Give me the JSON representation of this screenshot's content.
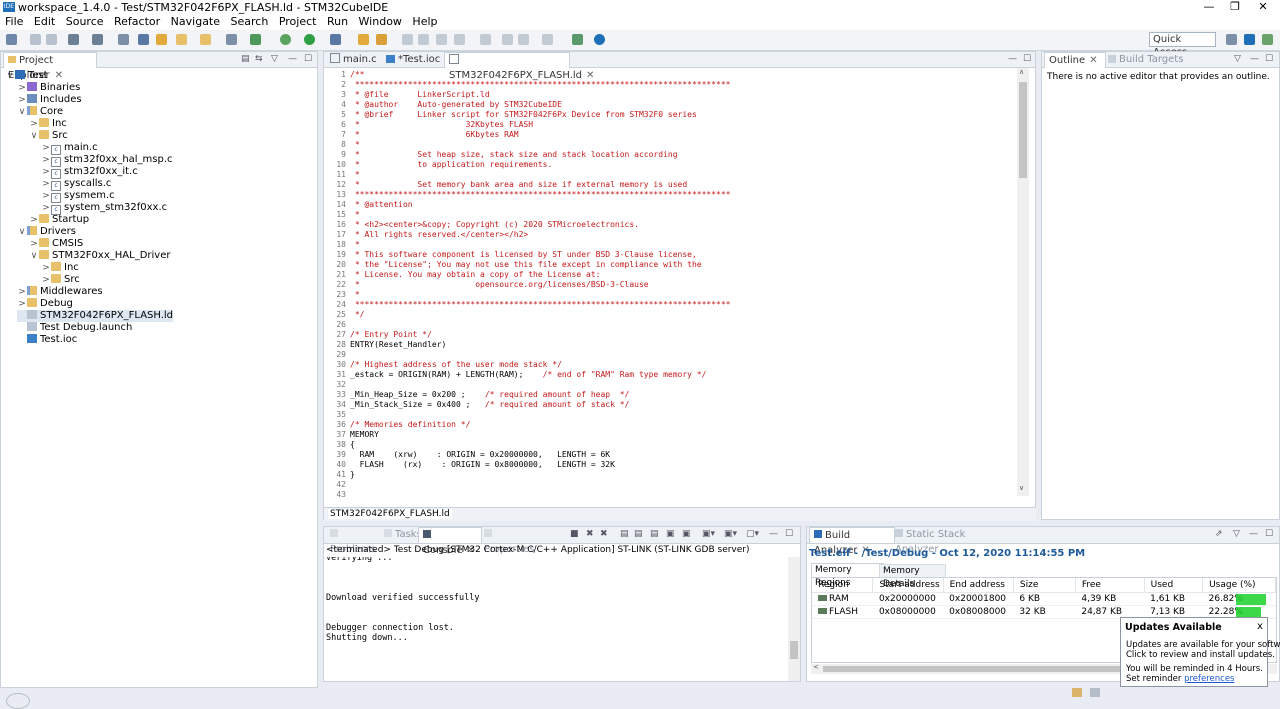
{
  "window": {
    "title": "workspace_1.4.0 - Test/STM32F042F6PX_FLASH.ld - STM32CubeIDE",
    "app_icon_label": "IDE",
    "minimize": "—",
    "restore": "❐",
    "close": "✕"
  },
  "menu": [
    "File",
    "Edit",
    "Source",
    "Refactor",
    "Navigate",
    "Search",
    "Project",
    "Run",
    "Window",
    "Help"
  ],
  "toolbar": {
    "quick_access_placeholder": "Quick Access"
  },
  "explorer": {
    "tab_label": "Project Explorer",
    "tree": [
      {
        "label": "Test",
        "indent": 0,
        "chev": "∨",
        "icon": "project-icon"
      },
      {
        "label": "Binaries",
        "indent": 1,
        "chev": ">",
        "icon": "binaries-icon"
      },
      {
        "label": "Includes",
        "indent": 1,
        "chev": ">",
        "icon": "includes-icon"
      },
      {
        "label": "Core",
        "indent": 1,
        "chev": "∨",
        "icon": "source-folder-icon"
      },
      {
        "label": "Inc",
        "indent": 2,
        "chev": ">",
        "icon": "folder-icon"
      },
      {
        "label": "Src",
        "indent": 2,
        "chev": "∨",
        "icon": "folder-icon"
      },
      {
        "label": "main.c",
        "indent": 3,
        "chev": ">",
        "icon": "c-file-icon"
      },
      {
        "label": "stm32f0xx_hal_msp.c",
        "indent": 3,
        "chev": ">",
        "icon": "c-file-icon"
      },
      {
        "label": "stm32f0xx_it.c",
        "indent": 3,
        "chev": ">",
        "icon": "c-file-icon"
      },
      {
        "label": "syscalls.c",
        "indent": 3,
        "chev": ">",
        "icon": "c-file-icon"
      },
      {
        "label": "sysmem.c",
        "indent": 3,
        "chev": ">",
        "icon": "c-file-icon"
      },
      {
        "label": "system_stm32f0xx.c",
        "indent": 3,
        "chev": ">",
        "icon": "c-file-icon"
      },
      {
        "label": "Startup",
        "indent": 2,
        "chev": ">",
        "icon": "folder-icon"
      },
      {
        "label": "Drivers",
        "indent": 1,
        "chev": "∨",
        "icon": "source-folder-icon"
      },
      {
        "label": "CMSIS",
        "indent": 2,
        "chev": ">",
        "icon": "folder-icon"
      },
      {
        "label": "STM32F0xx_HAL_Driver",
        "indent": 2,
        "chev": "∨",
        "icon": "folder-icon"
      },
      {
        "label": "Inc",
        "indent": 3,
        "chev": ">",
        "icon": "folder-icon"
      },
      {
        "label": "Src",
        "indent": 3,
        "chev": ">",
        "icon": "folder-icon"
      },
      {
        "label": "Middlewares",
        "indent": 1,
        "chev": ">",
        "icon": "source-folder-icon"
      },
      {
        "label": "Debug",
        "indent": 1,
        "chev": ">",
        "icon": "folder-icon"
      },
      {
        "label": "STM32F042F6PX_FLASH.ld",
        "indent": 1,
        "chev": "",
        "icon": "ld-file-icon",
        "selected": true
      },
      {
        "label": "Test Debug.launch",
        "indent": 1,
        "chev": "",
        "icon": "launch-file-icon"
      },
      {
        "label": "Test.ioc",
        "indent": 1,
        "chev": "",
        "icon": "ioc-file-icon"
      }
    ]
  },
  "editor": {
    "tabs": [
      "main.c",
      "*Test.ioc",
      "STM32F042F6PX_FLASH.ld"
    ],
    "footer_label": "STM32F042F6PX_FLASH.ld",
    "lines": [
      {
        "n": "1",
        "text": "/**",
        "c": true
      },
      {
        "n": "2",
        "text": " ******************************************************************************",
        "c": true
      },
      {
        "n": "3",
        "text": " * @file      LinkerScript.ld",
        "c": true
      },
      {
        "n": "4",
        "text": " * @author    Auto-generated by STM32CubeIDE",
        "c": true
      },
      {
        "n": "5",
        "text": " * @brief     Linker script for STM32F042F6Px Device from STM32F0 series",
        "c": true
      },
      {
        "n": "6",
        "text": " *                      32Kbytes FLASH",
        "c": true
      },
      {
        "n": "7",
        "text": " *                      6Kbytes RAM",
        "c": true
      },
      {
        "n": "8",
        "text": " *",
        "c": true
      },
      {
        "n": "9",
        "text": " *            Set heap size, stack size and stack location according",
        "c": true
      },
      {
        "n": "10",
        "text": " *            to application requirements.",
        "c": true
      },
      {
        "n": "11",
        "text": " *",
        "c": true
      },
      {
        "n": "12",
        "text": " *            Set memory bank area and size if external memory is used",
        "c": true
      },
      {
        "n": "13",
        "text": " ******************************************************************************",
        "c": true
      },
      {
        "n": "14",
        "text": " * @attention",
        "c": true
      },
      {
        "n": "15",
        "text": " *",
        "c": true
      },
      {
        "n": "16",
        "text": " * <h2><center>&copy; Copyright (c) 2020 STMicroelectronics.",
        "c": true
      },
      {
        "n": "17",
        "text": " * All rights reserved.</center></h2>",
        "c": true
      },
      {
        "n": "18",
        "text": " *",
        "c": true
      },
      {
        "n": "19",
        "text": " * This software component is licensed by ST under BSD 3-Clause license,",
        "c": true
      },
      {
        "n": "20",
        "text": " * the \"License\"; You may not use this file except in compliance with the",
        "c": true
      },
      {
        "n": "21",
        "text": " * License. You may obtain a copy of the License at:",
        "c": true
      },
      {
        "n": "22",
        "text": " *                        opensource.org/licenses/BSD-3-Clause",
        "c": true
      },
      {
        "n": "23",
        "text": " *",
        "c": true
      },
      {
        "n": "24",
        "text": " ******************************************************************************",
        "c": true
      },
      {
        "n": "25",
        "text": " */",
        "c": true
      },
      {
        "n": "26",
        "text": "",
        "c": false
      },
      {
        "n": "27",
        "text": "/* Entry Point */",
        "c": true
      },
      {
        "n": "28",
        "text": "ENTRY(Reset_Handler)",
        "c": false
      },
      {
        "n": "29",
        "text": "",
        "c": false
      },
      {
        "n": "30",
        "text": "/* Highest address of the user mode stack */",
        "c": true
      },
      {
        "n": "31",
        "text": "_estack = ORIGIN(RAM) + LENGTH(RAM);",
        "tail": "    /* end of \"RAM\" Ram type memory */",
        "c": false
      },
      {
        "n": "32",
        "text": "",
        "c": false
      },
      {
        "n": "33",
        "text": "_Min_Heap_Size = 0x200 ;",
        "tail": "    /* required amount of heap  */",
        "c": false
      },
      {
        "n": "34",
        "text": "_Min_Stack_Size = 0x400 ;",
        "tail": "   /* required amount of stack */",
        "c": false
      },
      {
        "n": "35",
        "text": "",
        "c": false
      },
      {
        "n": "36",
        "text": "/* Memories definition */",
        "c": true
      },
      {
        "n": "37",
        "text": "MEMORY",
        "c": false
      },
      {
        "n": "38",
        "text": "{",
        "c": false
      },
      {
        "n": "39",
        "text": "  RAM    (xrw)    : ORIGIN = 0x20000000,   LENGTH = 6K",
        "c": false
      },
      {
        "n": "40",
        "text": "  FLASH    (rx)    : ORIGIN = 0x8000000,   LENGTH = 32K",
        "c": false
      },
      {
        "n": "41",
        "text": "}",
        "c": false
      },
      {
        "n": "42",
        "text": "",
        "c": false
      },
      {
        "n": "43",
        "text": "/* Sections */",
        "c": true
      }
    ]
  },
  "outline": {
    "tabs": [
      "Outline",
      "Build Targets"
    ],
    "message": "There is no active editor that provides an outline."
  },
  "console": {
    "tabs": [
      "Problems",
      "Tasks",
      "Console",
      "Properties"
    ],
    "header": "<terminated> Test Debug [STM32 Cortex-M C/C++ Application] ST-LINK (ST-LINK GDB server)",
    "lines": [
      "Verifying ...",
      "",
      "",
      "",
      "Download verified successfully",
      "",
      "",
      "Debugger connection lost.",
      "Shutting down..."
    ]
  },
  "build": {
    "tabs": [
      "Build Analyzer",
      "Static Stack Analyzer"
    ],
    "title": "Test.elf - /Test/Debug - Oct 12, 2020 11:14:55 PM",
    "subtabs": [
      "Memory Regions",
      "Memory Details"
    ],
    "columns": [
      "Region",
      "Start address",
      "End address",
      "Size",
      "Free",
      "Used",
      "Usage (%)"
    ],
    "rows": [
      {
        "region": "RAM",
        "start": "0x20000000",
        "end": "0x20001800",
        "size": "6 KB",
        "free": "4,39 KB",
        "used": "1,61 KB",
        "usage": "26.82%",
        "fill": 0.2682
      },
      {
        "region": "FLASH",
        "start": "0x08000000",
        "end": "0x08008000",
        "size": "32 KB",
        "free": "24,87 KB",
        "used": "7,13 KB",
        "usage": "22.28%",
        "fill": 0.2228
      }
    ]
  },
  "popup": {
    "title": "Updates Available",
    "line1": "Updates are available for your software.",
    "line2": "Click to review and install updates.",
    "line3": "You will be reminded in 4 Hours.",
    "line4_prefix": "Set reminder",
    "link": "preferences",
    "close": "x"
  },
  "colors": {
    "accent": "#1e6fb8",
    "usage_bar": "#1bd12a",
    "comment": "#c31a1a"
  }
}
